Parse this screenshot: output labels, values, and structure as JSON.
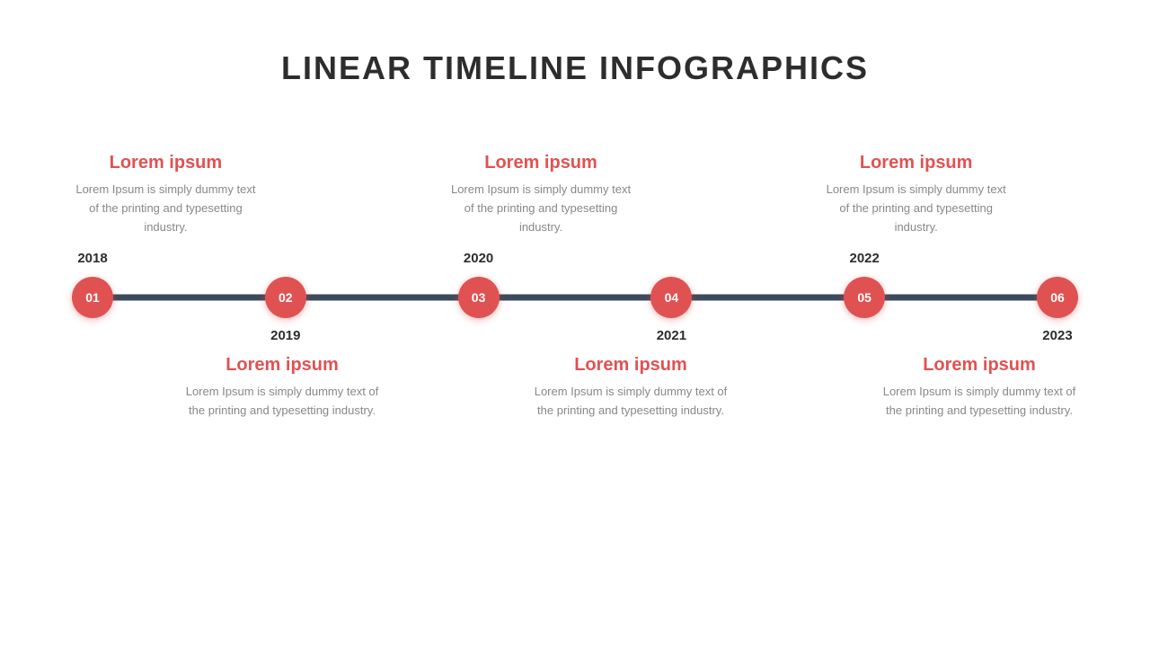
{
  "title": "LINEAR TIMELINE INFOGRAPHICS",
  "colors": {
    "accent": "#e05252",
    "dark": "#3d4a5c",
    "text_dark": "#2d2d2d",
    "text_gray": "#888888",
    "text_white": "#ffffff"
  },
  "top_items": [
    {
      "node": "01",
      "year": "2018",
      "title": "Lorem ipsum",
      "text": "Lorem Ipsum is simply dummy text of the printing and typesetting industry."
    },
    {
      "node": "03",
      "year": "2020",
      "title": "Lorem ipsum",
      "text": "Lorem Ipsum is simply dummy text of the printing and typesetting industry."
    },
    {
      "node": "05",
      "year": "2022",
      "title": "Lorem ipsum",
      "text": "Lorem Ipsum is simply dummy text of the printing and typesetting industry."
    }
  ],
  "bottom_items": [
    {
      "node": "02",
      "year": "2019",
      "title": "Lorem ipsum",
      "text": "Lorem Ipsum is simply dummy text of the printing and typesetting industry."
    },
    {
      "node": "04",
      "year": "2021",
      "title": "Lorem ipsum",
      "text": "Lorem Ipsum is simply dummy text of the printing and typesetting industry."
    },
    {
      "node": "06",
      "year": "2023",
      "title": "Lorem ipsum",
      "text": "Lorem Ipsum is simply dummy text of the printing and typesetting industry."
    }
  ],
  "all_nodes": [
    "01",
    "02",
    "03",
    "04",
    "05",
    "06"
  ]
}
